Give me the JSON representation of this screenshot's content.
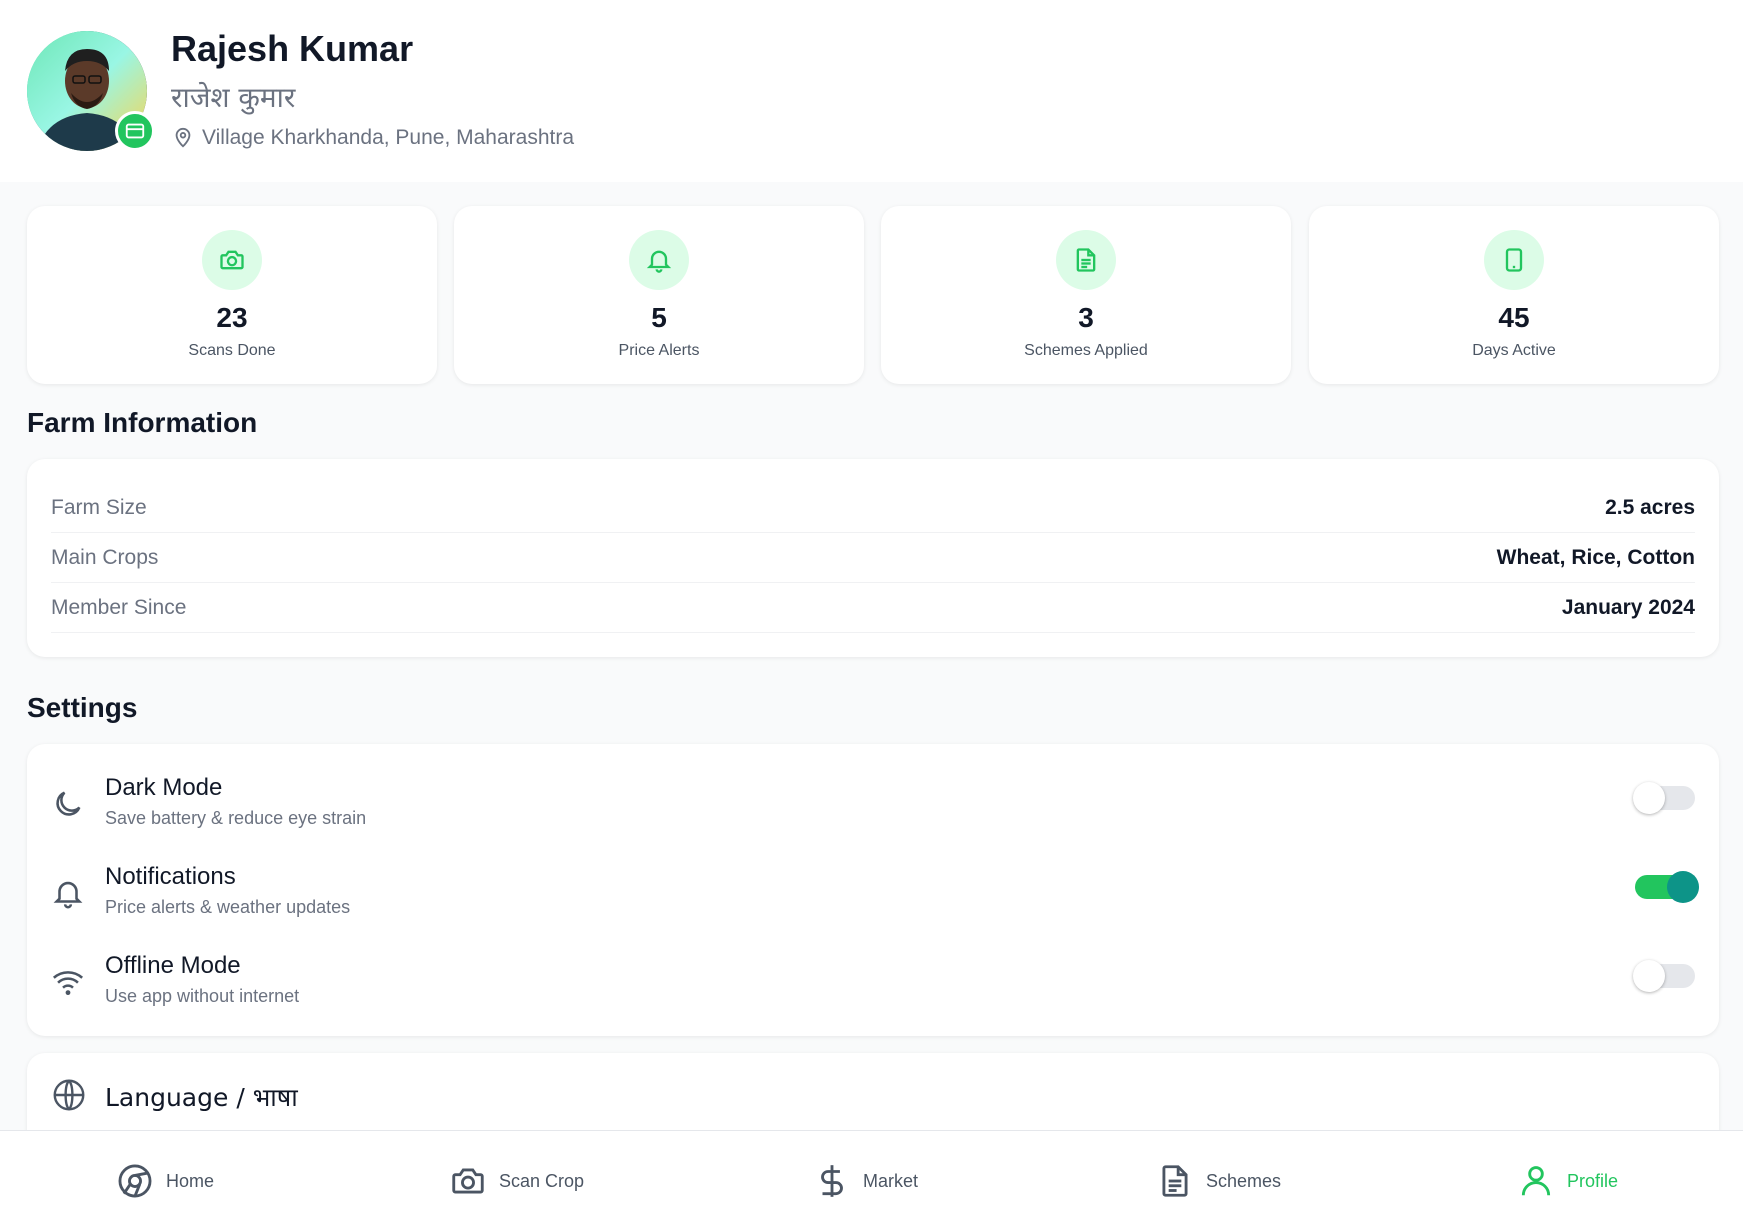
{
  "profile": {
    "name": "Rajesh Kumar",
    "name_hi": "राजेश कुमार",
    "location": "Village Kharkhanda, Pune, Maharashtra"
  },
  "stats": [
    {
      "icon": "camera-icon",
      "value": "23",
      "label": "Scans Done"
    },
    {
      "icon": "bell-icon",
      "value": "5",
      "label": "Price Alerts"
    },
    {
      "icon": "document-icon",
      "value": "3",
      "label": "Schemes Applied"
    },
    {
      "icon": "phone-icon",
      "value": "45",
      "label": "Days Active"
    }
  ],
  "farm": {
    "title": "Farm Information",
    "rows": [
      {
        "key": "Farm Size",
        "value": "2.5 acres"
      },
      {
        "key": "Main Crops",
        "value": "Wheat, Rice, Cotton"
      },
      {
        "key": "Member Since",
        "value": "January 2024"
      }
    ]
  },
  "settings": {
    "title": "Settings",
    "items": [
      {
        "icon": "moon-icon",
        "title": "Dark Mode",
        "subtitle": "Save battery & reduce eye strain",
        "enabled": false
      },
      {
        "icon": "bell-icon",
        "title": "Notifications",
        "subtitle": "Price alerts & weather updates",
        "enabled": true
      },
      {
        "icon": "wifi-icon",
        "title": "Offline Mode",
        "subtitle": "Use app without internet",
        "enabled": false
      }
    ],
    "language_label": "Language / भाषा"
  },
  "nav": {
    "items": [
      {
        "icon": "home-icon",
        "label": "Home"
      },
      {
        "icon": "camera-icon",
        "label": "Scan Crop"
      },
      {
        "icon": "dollar-icon",
        "label": "Market"
      },
      {
        "icon": "document-icon",
        "label": "Schemes"
      },
      {
        "icon": "user-icon",
        "label": "Profile"
      }
    ],
    "active": "Profile"
  },
  "colors": {
    "accent": "#22c55e",
    "accent_light": "#dcfce7",
    "toggle_knob_on": "#0d9488"
  }
}
